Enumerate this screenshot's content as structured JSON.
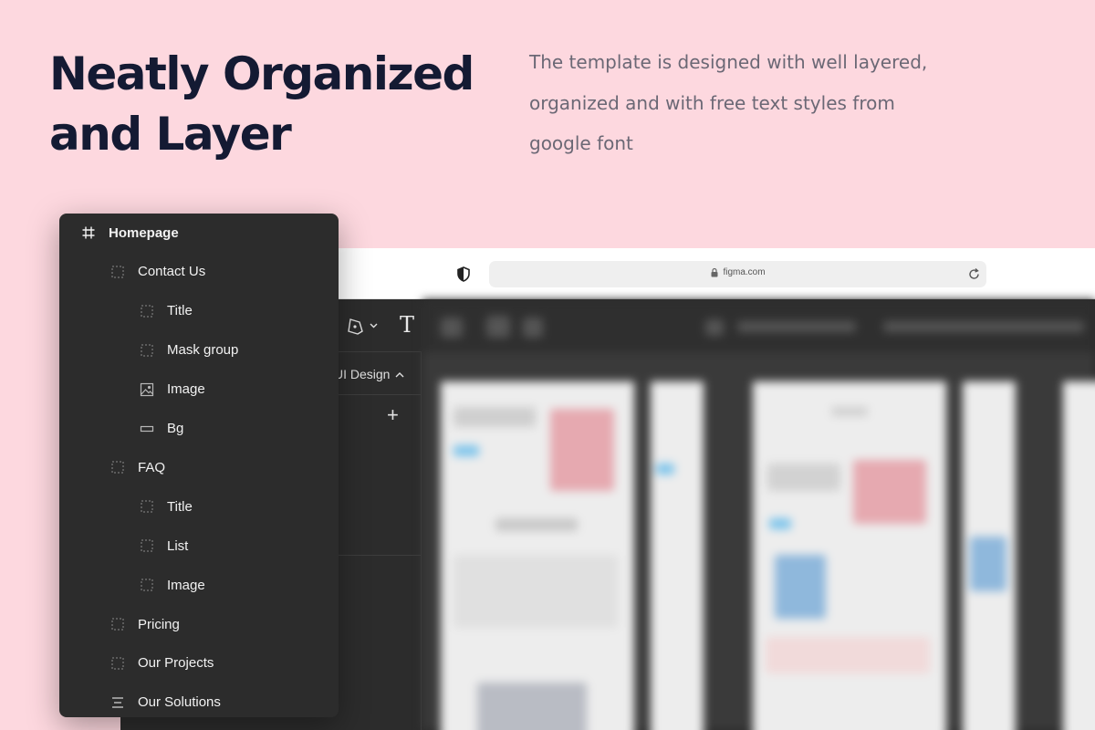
{
  "heading": {
    "line1": "Neatly Organized",
    "line2": "and Layer"
  },
  "description": {
    "line1": "The template is designed with well layered,",
    "line2": "organized and with free text styles from",
    "line3": "google font"
  },
  "browser": {
    "url": "figma.com"
  },
  "figma": {
    "page_selector": "UI Design"
  },
  "layers": [
    {
      "label": "Homepage",
      "icon": "frame-hash-icon",
      "level": 0
    },
    {
      "label": "Contact Us",
      "icon": "group-icon",
      "level": 1
    },
    {
      "label": "Title",
      "icon": "group-icon",
      "level": 2
    },
    {
      "label": "Mask group",
      "icon": "group-icon",
      "level": 2
    },
    {
      "label": "Image",
      "icon": "image-icon",
      "level": 2
    },
    {
      "label": "Bg",
      "icon": "rectangle-icon",
      "level": 2
    },
    {
      "label": "FAQ",
      "icon": "group-icon",
      "level": 1
    },
    {
      "label": "Title",
      "icon": "group-icon",
      "level": 2
    },
    {
      "label": "List",
      "icon": "group-icon",
      "level": 2
    },
    {
      "label": "Image",
      "icon": "group-icon",
      "level": 2
    },
    {
      "label": "Pricing",
      "icon": "group-icon",
      "level": 1
    },
    {
      "label": "Our Projects",
      "icon": "group-icon",
      "level": 1
    },
    {
      "label": "Our Solutions",
      "icon": "auto-layout-icon",
      "level": 1
    }
  ],
  "colors": {
    "background": "#fdd8df",
    "heading": "#141a33",
    "body_text": "#6b6875",
    "panel": "#2c2c2c"
  }
}
